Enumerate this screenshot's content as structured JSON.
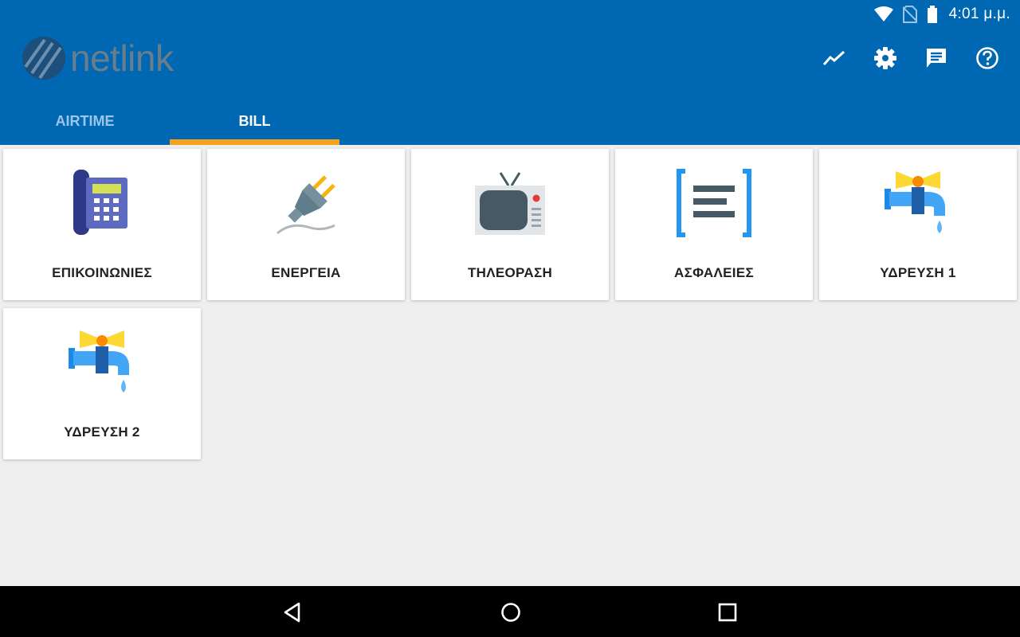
{
  "status_bar": {
    "time": "4:01 μ.μ."
  },
  "app": {
    "logo_text": "netlink"
  },
  "toolbar": {
    "icons": [
      "trending-up-icon",
      "gear-icon",
      "message-icon",
      "help-icon"
    ]
  },
  "tabs": [
    {
      "label": "AIRTIME",
      "active": false
    },
    {
      "label": "BILL",
      "active": true
    }
  ],
  "categories": [
    {
      "label": "ΕΠΙΚΟΙΝΩΝΙΕΣ",
      "icon": "telephone-icon"
    },
    {
      "label": "ΕΝΕΡΓΕΙΑ",
      "icon": "power-plug-icon"
    },
    {
      "label": "ΤΗΛΕΟΡΑΣΗ",
      "icon": "television-icon"
    },
    {
      "label": "ΑΣΦΑΛΕΙΕΣ",
      "icon": "insurance-document-icon"
    },
    {
      "label": "ΥΔΡΕΥΣΗ 1",
      "icon": "water-tap-icon"
    },
    {
      "label": "ΥΔΡΕΥΣΗ 2",
      "icon": "water-tap-icon"
    }
  ],
  "colors": {
    "primary": "#0068b3",
    "tab_indicator": "#f6a31b",
    "background": "#eeeeef"
  }
}
